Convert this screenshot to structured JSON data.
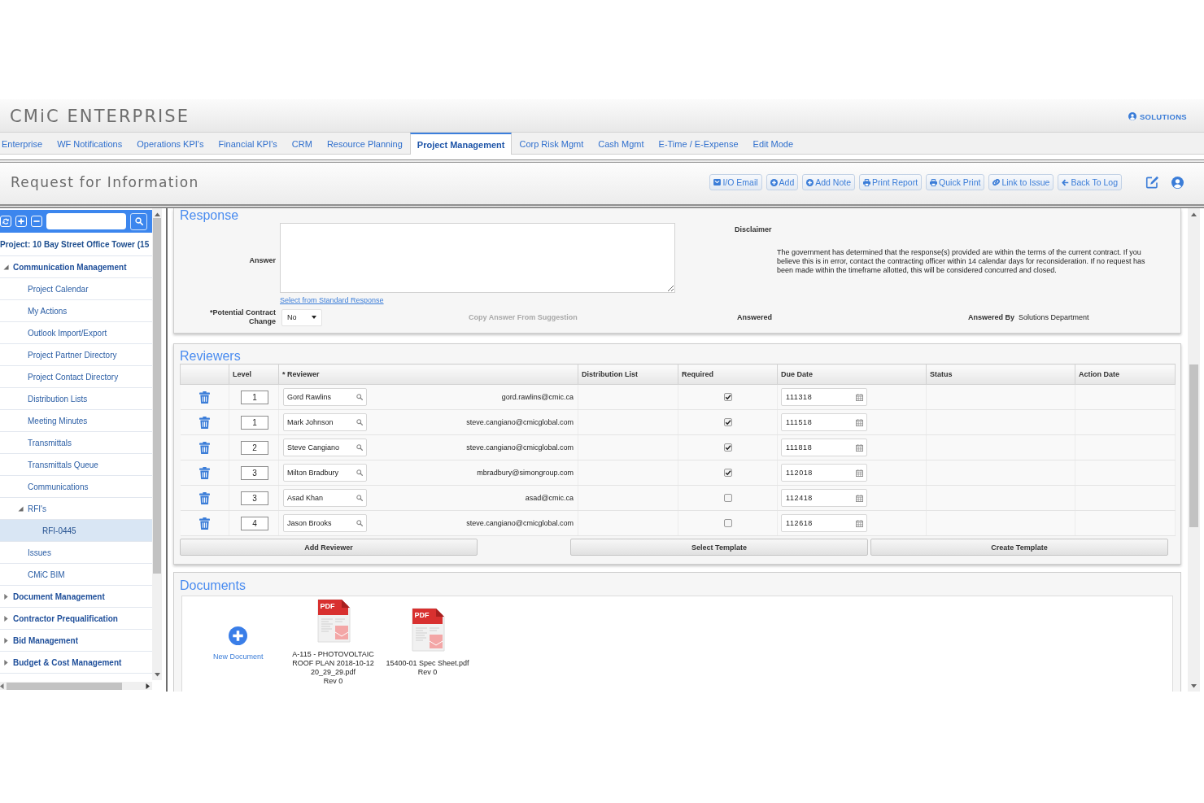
{
  "header": {
    "logo": "CMiC ENTERPRISE",
    "user": "SOLUTIONS"
  },
  "tabs": [
    {
      "label": "Enterprise",
      "selected": false
    },
    {
      "label": "WF Notifications",
      "selected": false
    },
    {
      "label": "Operations KPI's",
      "selected": false
    },
    {
      "label": "Financial KPI's",
      "selected": false
    },
    {
      "label": "CRM",
      "selected": false
    },
    {
      "label": "Resource Planning",
      "selected": false
    },
    {
      "label": "Project Management",
      "selected": true
    },
    {
      "label": "Corp Risk Mgmt",
      "selected": false
    },
    {
      "label": "Cash Mgmt",
      "selected": false
    },
    {
      "label": "E-Time / E-Expense",
      "selected": false
    },
    {
      "label": "Edit Mode",
      "selected": false
    }
  ],
  "page_header": {
    "title": "Request for Information",
    "actions": [
      {
        "label": "I/O Email",
        "kind": "email"
      },
      {
        "label": "Add",
        "kind": "add"
      },
      {
        "label": "Add Note",
        "kind": "add"
      },
      {
        "label": "Print Report",
        "kind": "print"
      },
      {
        "label": "Quick Print",
        "kind": "print"
      },
      {
        "label": "Link to Issue",
        "kind": "link"
      },
      {
        "label": "Back To Log",
        "kind": "back"
      }
    ]
  },
  "sidebar": {
    "project": "Project: 10 Bay Street Office Tower (15",
    "tree": [
      {
        "label": "Communication Management",
        "expanded": true,
        "selected": false,
        "children": [
          {
            "label": "Project Calendar",
            "selected": false
          },
          {
            "label": "My Actions",
            "selected": false
          },
          {
            "label": "Outlook Import/Export",
            "selected": false
          },
          {
            "label": "Project Partner Directory",
            "selected": false
          },
          {
            "label": "Project Contact Directory",
            "selected": false
          },
          {
            "label": "Distribution Lists",
            "selected": false
          },
          {
            "label": "Meeting Minutes",
            "selected": false
          },
          {
            "label": "Transmittals",
            "selected": false
          },
          {
            "label": "Transmittals Queue",
            "selected": false
          },
          {
            "label": "Communications",
            "selected": false
          },
          {
            "label": "RFI's",
            "expanded": true,
            "selected": false,
            "children": [
              {
                "label": "RFI-0445",
                "selected": true
              }
            ]
          },
          {
            "label": "Issues",
            "selected": false
          },
          {
            "label": "CMiC BIM",
            "selected": false
          }
        ]
      },
      {
        "label": "Document Management",
        "expanded": false,
        "selected": false
      },
      {
        "label": "Contractor Prequalification",
        "expanded": false,
        "selected": false
      },
      {
        "label": "Bid Management",
        "expanded": false,
        "selected": false
      },
      {
        "label": "Budget & Cost Management",
        "expanded": false,
        "selected": false
      }
    ]
  },
  "response": {
    "title": "Response",
    "answer_label": "Answer",
    "standard_response_link": "Select from Standard Response",
    "contract_change": {
      "label": "*Potential Contract Change",
      "value": "No"
    },
    "copy_answer": {
      "label": "Copy Answer From Suggestion",
      "disabled": true
    },
    "disclaimer": {
      "label": "Disclaimer",
      "text": "The government has determined that the response(s) provided are within the terms of the current contract.  If you believe this is in error, contact the contracting officer within 14 calendar days for reconsideration. If no request has been made within the timeframe allotted, this will be considered concurred and closed."
    },
    "answered_label": "Answered",
    "answered_by": {
      "label": "Answered By",
      "value": "Solutions Department"
    }
  },
  "reviewers": {
    "title": "Reviewers",
    "columns": [
      "Level",
      "* Reviewer",
      "Distribution List",
      "Required",
      "Due Date",
      "Status",
      "Action Date"
    ],
    "rows": [
      {
        "level": "1",
        "reviewer": "Gord Rawlins",
        "email": "gord.rawlins@cmic.ca",
        "required": true,
        "due_date": "111318"
      },
      {
        "level": "1",
        "reviewer": "Mark Johnson",
        "email": "steve.cangiano@cmicglobal.com",
        "required": true,
        "due_date": "111518"
      },
      {
        "level": "2",
        "reviewer": "Steve Cangiano",
        "email": "steve.cangiano@cmicglobal.com",
        "required": true,
        "due_date": "111818"
      },
      {
        "level": "3",
        "reviewer": "Milton Bradbury",
        "email": "mbradbury@simongroup.com",
        "required": true,
        "due_date": "112018"
      },
      {
        "level": "3",
        "reviewer": "Asad Khan",
        "email": "asad@cmic.ca",
        "required": false,
        "due_date": "112418"
      },
      {
        "level": "4",
        "reviewer": "Jason Brooks",
        "email": "steve.cangiano@cmicglobal.com",
        "required": false,
        "due_date": "112618"
      }
    ],
    "buttons": [
      "Add Reviewer",
      "Select Template",
      "Create Template"
    ]
  },
  "documents": {
    "title": "Documents",
    "new_document": "New Document",
    "files": [
      {
        "name": "A-115 - PHOTOVOLTAIC ROOF PLAN 2018-10-12 20_29_29.pdf",
        "type": "PDF",
        "revision": "Rev 0"
      },
      {
        "name": "15400-01 Spec Sheet.pdf",
        "type": "PDF",
        "revision": "Rev 0"
      }
    ]
  }
}
